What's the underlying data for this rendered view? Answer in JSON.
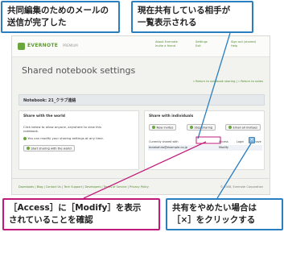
{
  "callouts": {
    "top_left": {
      "line1": "共同編集のためのメールの",
      "line2": "送信が完了した"
    },
    "top_right": {
      "line1": "現在共有している相手が",
      "line2": "一覧表示される"
    },
    "bottom_left": {
      "line1": "［Access］に［Modify］を表示",
      "line2": "されていることを確認"
    },
    "bottom_right": {
      "line1": "共有をやめたい場合は",
      "line2": "［×］をクリックする"
    }
  },
  "app": {
    "logo": "EVERNOTE",
    "logo_sub": "PREMIUM",
    "top_links": [
      {
        "line1": "About Evernote",
        "line2": "Invite a friend"
      },
      {
        "line1": "Settings",
        "line2": "Exit"
      },
      {
        "line1": "Sign out (shared)",
        "line2": "Help"
      }
    ],
    "page_title": "Shared notebook settings",
    "sub_links": "« Return to notebook sharing  |  « Return to notes",
    "notebook_label": "Notebook: 21_クラブ連絡",
    "left_pane": {
      "heading": "Share with the world",
      "desc1": "Click below to allow anyone, anywhere to view this",
      "desc2": "notebook.",
      "note": "You can modify your sharing settings at any time.",
      "button": "Start sharing with the world"
    },
    "right_pane": {
      "heading": "Share with individuals",
      "buttons": [
        "New invites",
        "Stop sharing",
        "Email all invitees"
      ],
      "headers": {
        "who": "Currently shared with",
        "access": "Access",
        "login": "Login",
        "remove": "Remove"
      },
      "row": {
        "email": "tanakahiro@example.co.jp",
        "access": "Modify",
        "login": "",
        "remove": "×"
      }
    },
    "footer": {
      "links": "Downloads | Blog | Contact Us | Tech Support | Developers | Terms of Service | Privacy Policy",
      "copyright": "© 2008, Evernote Corporation"
    }
  },
  "colors": {
    "callout_border": "#2a7fc0",
    "accent_arrow": "#c0197a",
    "brand_green": "#6aa63b"
  }
}
